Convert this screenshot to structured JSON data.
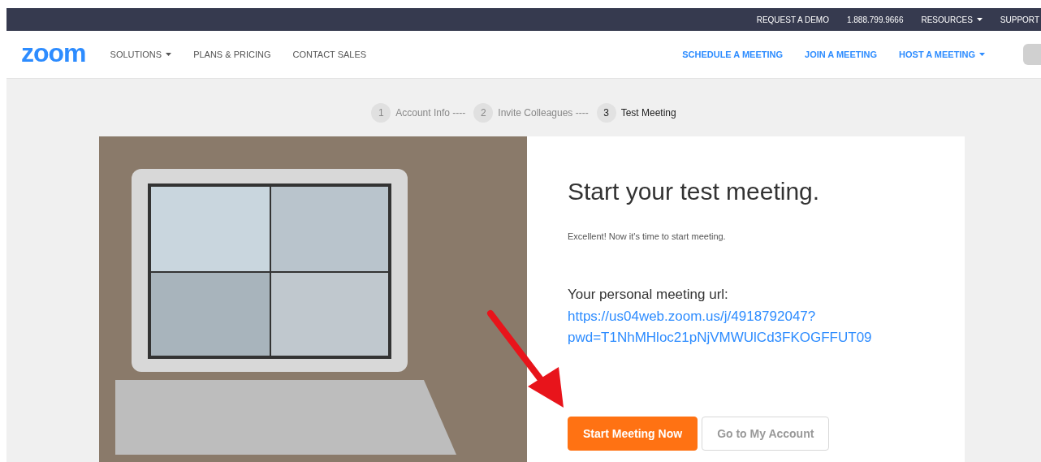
{
  "top_bar": {
    "links": [
      {
        "label": "REQUEST A DEMO",
        "dropdown": false
      },
      {
        "label": "1.888.799.9666",
        "dropdown": false
      },
      {
        "label": "RESOURCES",
        "dropdown": true
      },
      {
        "label": "SUPPORT",
        "dropdown": false
      }
    ]
  },
  "nav": {
    "logo": "zoom",
    "left_links": [
      {
        "label": "SOLUTIONS",
        "dropdown": true
      },
      {
        "label": "PLANS & PRICING",
        "dropdown": false
      },
      {
        "label": "CONTACT SALES",
        "dropdown": false
      }
    ],
    "right_links": [
      {
        "label": "SCHEDULE A MEETING",
        "dropdown": false
      },
      {
        "label": "JOIN A MEETING",
        "dropdown": false
      },
      {
        "label": "HOST A MEETING",
        "dropdown": true
      }
    ]
  },
  "steps": [
    {
      "number": "1",
      "label": "Account Info ----",
      "selected": false
    },
    {
      "number": "2",
      "label": "Invite Colleagues ----",
      "selected": false
    },
    {
      "number": "3",
      "label": "Test Meeting",
      "selected": true
    }
  ],
  "panel": {
    "title": "Start your test meeting.",
    "subtitle": "Excellent! Now it's time to start meeting.",
    "url_label": "Your personal meeting url:",
    "url_lines": [
      "https://us04web.zoom.us/j/4918792047?",
      "pwd=T1NhMHloc21pNjVMWUlCd3FKOGFFUT09"
    ],
    "buttons": [
      {
        "label": "Start Meeting Now",
        "kind": "primary"
      },
      {
        "label": "Go to My Account",
        "kind": "secondary"
      }
    ]
  }
}
